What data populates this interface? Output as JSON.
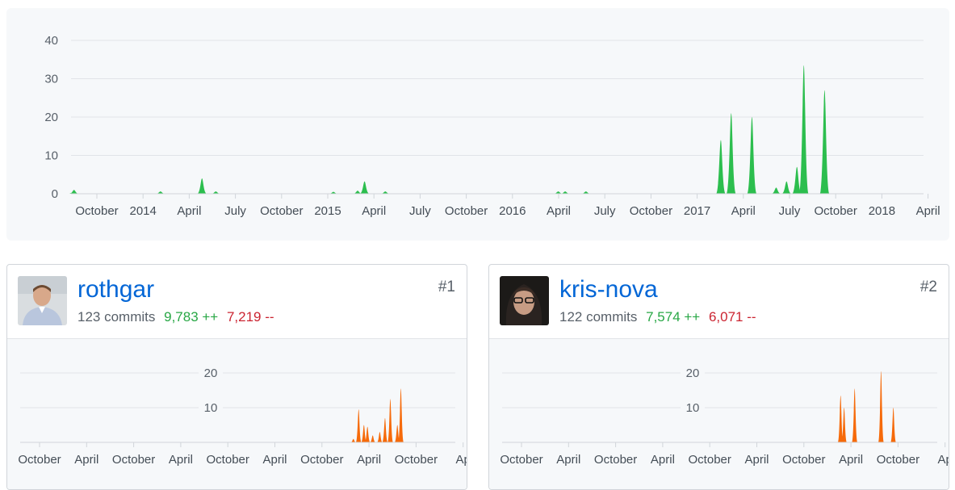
{
  "overview": {
    "y_ticks": [
      "0",
      "10",
      "20",
      "30",
      "40"
    ],
    "x_labels": [
      "October",
      "2014",
      "April",
      "July",
      "October",
      "2015",
      "April",
      "July",
      "October",
      "2016",
      "April",
      "July",
      "October",
      "2017",
      "April",
      "July",
      "October",
      "2018",
      "April"
    ],
    "color": "#2cbe4e",
    "chart_data": {
      "type": "area",
      "ylim": [
        0,
        40
      ],
      "x_start": "2013-07",
      "x_end": "2018-04",
      "points": [
        {
          "x": "2013-07-07",
          "y": 1.0
        },
        {
          "x": "2013-12-29",
          "y": 0.6
        },
        {
          "x": "2014-03-23",
          "y": 4.0
        },
        {
          "x": "2014-04-20",
          "y": 0.6
        },
        {
          "x": "2014-12-14",
          "y": 0.5
        },
        {
          "x": "2015-02-01",
          "y": 0.8
        },
        {
          "x": "2015-02-15",
          "y": 3.2
        },
        {
          "x": "2015-03-29",
          "y": 0.6
        },
        {
          "x": "2016-03-13",
          "y": 0.6
        },
        {
          "x": "2016-03-27",
          "y": 0.6
        },
        {
          "x": "2016-05-08",
          "y": 0.6
        },
        {
          "x": "2017-02-05",
          "y": 14.0
        },
        {
          "x": "2017-02-26",
          "y": 21.0
        },
        {
          "x": "2017-04-09",
          "y": 20.0
        },
        {
          "x": "2017-05-28",
          "y": 1.6
        },
        {
          "x": "2017-06-18",
          "y": 3.2
        },
        {
          "x": "2017-07-09",
          "y": 7.0
        },
        {
          "x": "2017-07-23",
          "y": 33.5
        },
        {
          "x": "2017-09-03",
          "y": 27.0
        }
      ]
    }
  },
  "contributors": [
    {
      "username": "rothgar",
      "rank": "#1",
      "commits": "123 commits",
      "additions": "9,783 ++",
      "deletions": "7,219 --",
      "y_ticks": [
        "10",
        "20"
      ],
      "x_labels": [
        "October",
        "April",
        "October",
        "April",
        "October",
        "April",
        "October",
        "April",
        "October",
        "Ap"
      ],
      "color": "#f66a0a",
      "chart_data": {
        "type": "area",
        "ylim": [
          0,
          25
        ],
        "points": [
          {
            "x": "2017-01-15",
            "y": 1.0
          },
          {
            "x": "2017-02-05",
            "y": 9.5
          },
          {
            "x": "2017-02-26",
            "y": 5.0
          },
          {
            "x": "2017-03-12",
            "y": 4.5
          },
          {
            "x": "2017-04-02",
            "y": 2.0
          },
          {
            "x": "2017-04-30",
            "y": 3.0
          },
          {
            "x": "2017-05-21",
            "y": 7.0
          },
          {
            "x": "2017-06-11",
            "y": 12.5
          },
          {
            "x": "2017-07-09",
            "y": 5.0
          },
          {
            "x": "2017-07-23",
            "y": 15.5
          }
        ]
      }
    },
    {
      "username": "kris-nova",
      "rank": "#2",
      "commits": "122 commits",
      "additions": "7,574 ++",
      "deletions": "6,071 --",
      "y_ticks": [
        "10",
        "20"
      ],
      "x_labels": [
        "October",
        "April",
        "October",
        "April",
        "October",
        "April",
        "October",
        "April",
        "October",
        "Ap"
      ],
      "color": "#f66a0a",
      "chart_data": {
        "type": "area",
        "ylim": [
          0,
          25
        ],
        "points": [
          {
            "x": "2017-02-05",
            "y": 13.5
          },
          {
            "x": "2017-02-19",
            "y": 10.0
          },
          {
            "x": "2017-04-02",
            "y": 15.5
          },
          {
            "x": "2017-07-16",
            "y": 20.5
          },
          {
            "x": "2017-09-03",
            "y": 10.0
          }
        ]
      }
    }
  ]
}
